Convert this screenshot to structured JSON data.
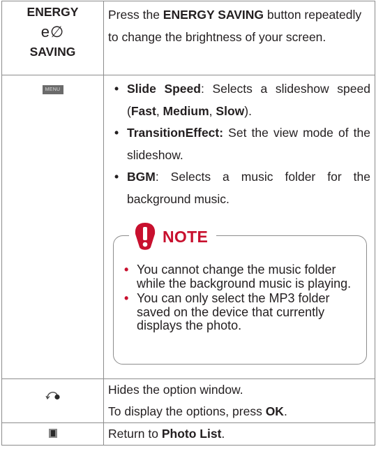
{
  "energy_row": {
    "key_line1": "ENERGY",
    "key_icon_glyph": "e∅",
    "key_line2": "SAVING",
    "desc_pre": "Press the ",
    "desc_bold": "ENERGY SAVING",
    "desc_post": " button repeatedly to change the brightness of your screen."
  },
  "menu_row": {
    "key_label": "MENU",
    "bullet_glyph": "•",
    "items": [
      {
        "bold": "Slide Speed",
        "text": ": Selects a slideshow speed (",
        "opt1": "Fast",
        "sep1": ", ",
        "opt2": "Medium",
        "sep2": ", ",
        "opt3": "Slow",
        "tail": ")."
      },
      {
        "bold": "TransitionEffect:",
        "text": " Set the view mode of the slideshow."
      },
      {
        "bold": "BGM",
        "text": ": Selects a music folder for the background music."
      }
    ],
    "note": {
      "title": "NOTE",
      "bullet_glyph": "•",
      "items": [
        "You cannot change the music folder while the background music is playing.",
        "You can only select the MP3 folder saved on the device that currently displays the photo."
      ]
    }
  },
  "back_row": {
    "icon": "back-arrow-icon",
    "line1": "Hides the option window.",
    "line2_pre": "To display the options, press ",
    "line2_bold": "OK",
    "line2_post": "."
  },
  "photo_row": {
    "icon": "photo-list-icon",
    "pre": "Return to ",
    "bold": "Photo List",
    "post": "."
  },
  "colors": {
    "border": "#8c8c8c",
    "note_accent": "#c8102e",
    "text": "#231f20",
    "menu_button": "#6b6b6b"
  }
}
